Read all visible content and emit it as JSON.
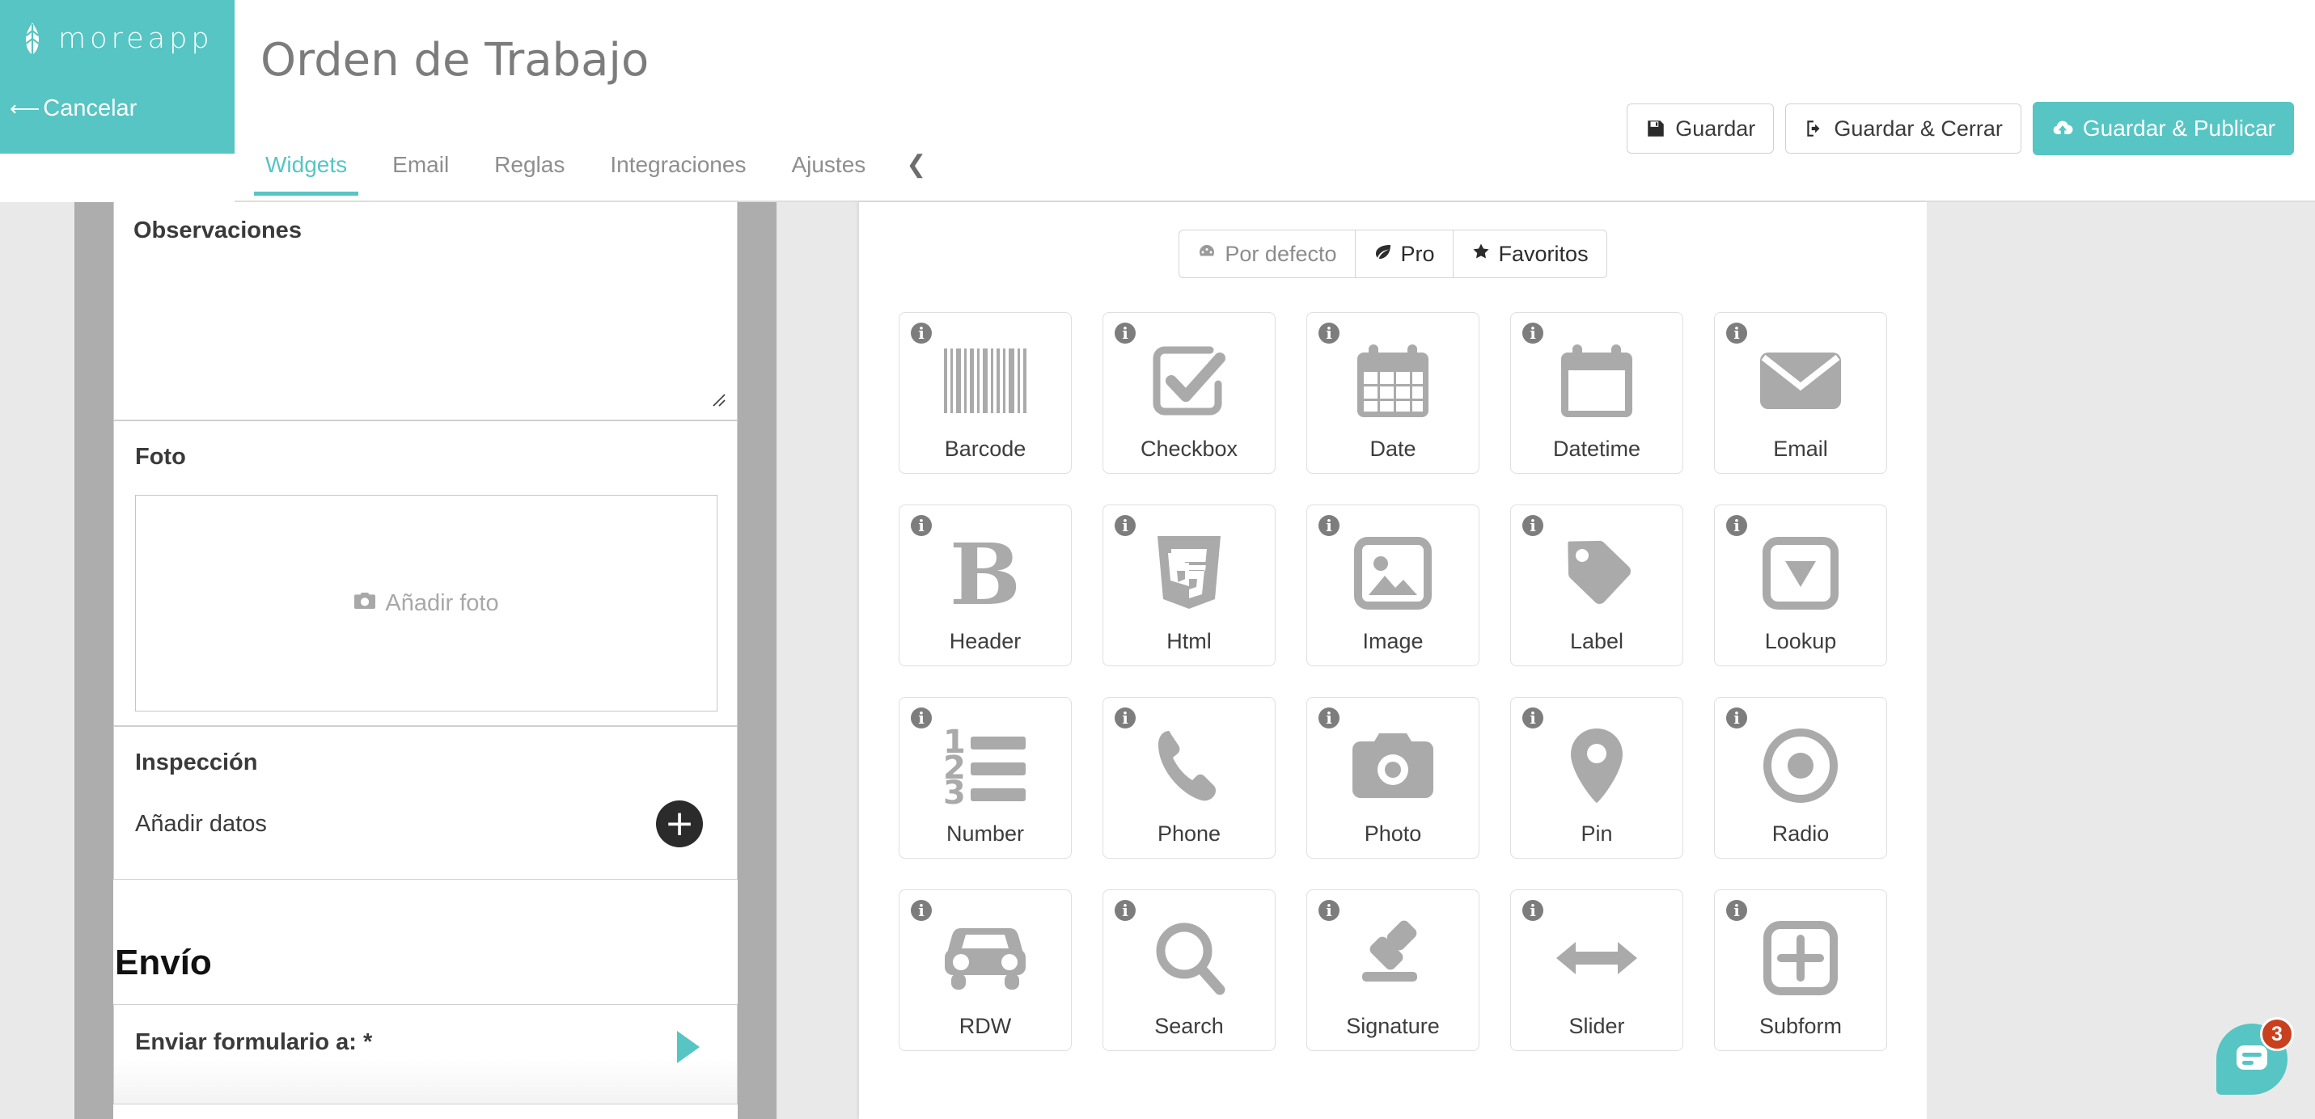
{
  "brand": {
    "name": "moreapp",
    "logo_icon": "leaf-icon",
    "color": "#56c5c3"
  },
  "header": {
    "cancel_label": "Cancelar",
    "cancel_icon": "arrow-left-icon",
    "title": "Orden de Trabajo"
  },
  "tabs": {
    "items": [
      {
        "label": "Widgets",
        "active": true
      },
      {
        "label": "Email",
        "active": false
      },
      {
        "label": "Reglas",
        "active": false
      },
      {
        "label": "Integraciones",
        "active": false
      },
      {
        "label": "Ajustes",
        "active": false
      }
    ],
    "collapse_icon": "chevron-left-icon"
  },
  "actions": [
    {
      "label": "Guardar",
      "icon": "save-disk-icon",
      "primary": false
    },
    {
      "label": "Guardar & Cerrar",
      "icon": "sign-out-icon",
      "primary": false
    },
    {
      "label": "Guardar & Publicar",
      "icon": "cloud-upload-icon",
      "primary": true
    }
  ],
  "form": {
    "fields": [
      {
        "name": "observaciones",
        "label": "Observaciones",
        "type": "textarea",
        "value": "",
        "resize_handle": true
      },
      {
        "name": "foto",
        "label": "Foto",
        "type": "photo",
        "placeholder": "Añadir foto",
        "placeholder_icon": "camera-icon"
      },
      {
        "name": "inspeccion",
        "label": "Inspección",
        "type": "subform",
        "add_label": "Añadir datos",
        "add_icon": "plus-circle-icon"
      }
    ],
    "section": {
      "title": "Envío",
      "field": {
        "name": "enviar-formulario",
        "label": "Enviar formulario a: *",
        "chevron_icon": "triangle-right-icon"
      }
    }
  },
  "widget_panel": {
    "segments": [
      {
        "label": "Por defecto",
        "icon": "dashboard-icon",
        "active": false
      },
      {
        "label": "Pro",
        "icon": "leaf-icon",
        "active": false
      },
      {
        "label": "Favoritos",
        "icon": "star-icon",
        "active": false
      }
    ],
    "widgets": [
      {
        "label": "Barcode",
        "icon": "barcode-icon",
        "info_icon": "info-icon"
      },
      {
        "label": "Checkbox",
        "icon": "checkbox-icon",
        "info_icon": "info-icon"
      },
      {
        "label": "Date",
        "icon": "calendar-icon",
        "info_icon": "info-icon"
      },
      {
        "label": "Datetime",
        "icon": "calendar-blank-icon",
        "info_icon": "info-icon"
      },
      {
        "label": "Email",
        "icon": "envelope-icon",
        "info_icon": "info-icon"
      },
      {
        "label": "Header",
        "icon": "bold-b-icon",
        "info_icon": "info-icon"
      },
      {
        "label": "Html",
        "icon": "html5-icon",
        "info_icon": "info-icon"
      },
      {
        "label": "Image",
        "icon": "image-icon",
        "info_icon": "info-icon"
      },
      {
        "label": "Label",
        "icon": "tag-icon",
        "info_icon": "info-icon"
      },
      {
        "label": "Lookup",
        "icon": "lookup-icon",
        "info_icon": "info-icon"
      },
      {
        "label": "Number",
        "icon": "ordered-list-icon",
        "info_icon": "info-icon"
      },
      {
        "label": "Phone",
        "icon": "phone-icon",
        "info_icon": "info-icon"
      },
      {
        "label": "Photo",
        "icon": "camera-icon",
        "info_icon": "info-icon"
      },
      {
        "label": "Pin",
        "icon": "map-pin-icon",
        "info_icon": "info-icon"
      },
      {
        "label": "Radio",
        "icon": "radio-dot-icon",
        "info_icon": "info-icon"
      },
      {
        "label": "RDW",
        "icon": "car-icon",
        "info_icon": "info-icon"
      },
      {
        "label": "Search",
        "icon": "magnifier-icon",
        "info_icon": "info-icon"
      },
      {
        "label": "Signature",
        "icon": "pen-icon",
        "info_icon": "info-icon"
      },
      {
        "label": "Slider",
        "icon": "double-arrow-icon",
        "info_icon": "info-icon"
      },
      {
        "label": "Subform",
        "icon": "plus-square-icon",
        "info_icon": "info-icon"
      }
    ]
  },
  "chat": {
    "badge_count": "3",
    "icon": "chat-bubble-icon"
  }
}
